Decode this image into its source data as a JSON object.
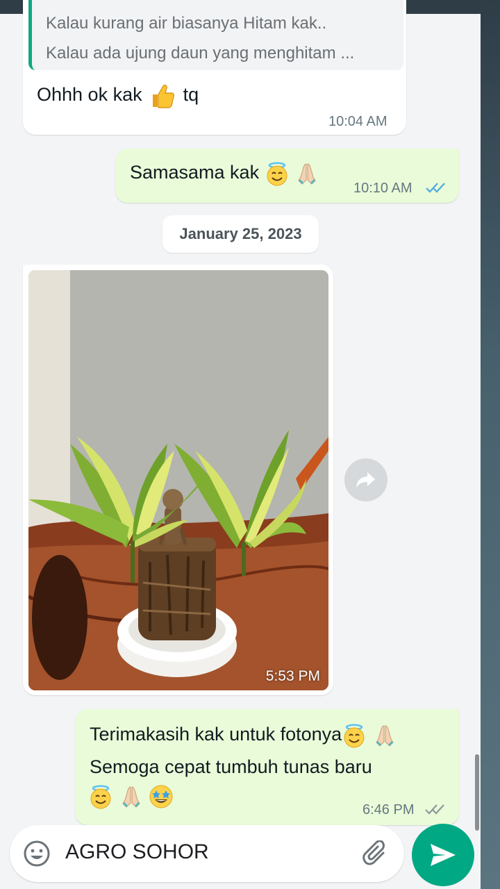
{
  "messages": {
    "m1": {
      "quote_line_1": "Kalau kurang air biasanya Hitam kak..",
      "quote_line_2": "Kalau ada ujung daun yang menghitam ...",
      "text": "Ohhh ok kak",
      "text_after": "tq",
      "time": "10:04 AM"
    },
    "m2": {
      "text": "Samasama kak",
      "time": "10:10 AM"
    },
    "date_separator": "January 25, 2023",
    "m3": {
      "time": "5:53 PM"
    },
    "m4": {
      "line_1": "Terimakasih kak untuk fotonya",
      "line_2": "Semoga cepat tumbuh tunas baru",
      "time": "6:46 PM"
    }
  },
  "input": {
    "value": "AGRO SOHOR"
  },
  "icons": {
    "emoji": "emoji-icon",
    "attach": "paperclip-icon",
    "send": "send-icon",
    "forward": "forward-icon",
    "read_receipt": "double-check-icon"
  },
  "colors": {
    "accent": "#00a884",
    "outgoing_bubble": "#e9fbd8",
    "incoming_bubble": "#ffffff",
    "read_ticks": "#4fa8e0",
    "quote_bar": "#0fa983"
  }
}
